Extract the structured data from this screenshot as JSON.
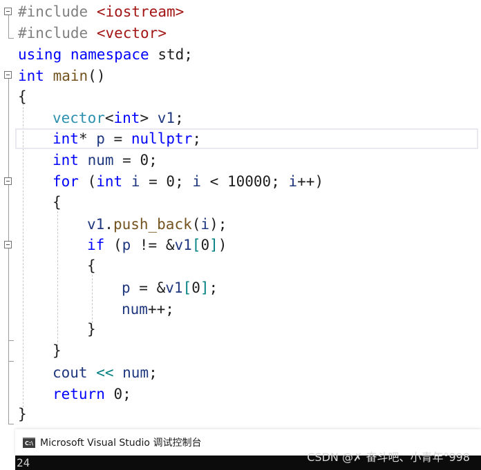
{
  "code": {
    "l1": {
      "t1": "#include",
      "t2": "<iostream>"
    },
    "l2": {
      "t1": "#include",
      "t2": "<vector>"
    },
    "l3": {
      "t1": "using",
      "t2": "namespace",
      "t3": "std;"
    },
    "l4": {
      "t1": "int",
      "t2": "main",
      "t3": "()"
    },
    "l5": {
      "t1": "{"
    },
    "l6": {
      "t1": "vector",
      "t2": "<",
      "t3": "int",
      "t4": ">",
      "t5": "v1",
      "t6": ";"
    },
    "l7": {
      "t1": "int",
      "t2": "*",
      "t3": "p",
      "t4": " = ",
      "t5": "nullptr",
      "t6": ";"
    },
    "l8": {
      "t1": "int",
      "t2": "num",
      "t3": " = ",
      "t4": "0",
      "t5": ";"
    },
    "l9": {
      "t1": "for",
      "t2": " (",
      "t3": "int",
      "t4": "i",
      "t5": " = ",
      "t6": "0",
      "t7": "; ",
      "t8": "i",
      "t9": " < ",
      "t10": "10000",
      "t11": "; ",
      "t12": "i",
      "t13": "++",
      "t14": ")"
    },
    "l10": {
      "t1": "{"
    },
    "l11": {
      "t1": "v1",
      "t2": ".",
      "t3": "push_back",
      "t4": "(",
      "t5": "i",
      "t6": ");"
    },
    "l12": {
      "t1": "if",
      "t2": " (",
      "t3": "p",
      "t4": " != ",
      "t5": "&",
      "t6": "v1",
      "t7": "[",
      "t8": "0",
      "t9": "]",
      "t10": ")"
    },
    "l13": {
      "t1": "{"
    },
    "l14": {
      "t1": "p",
      "t2": " = ",
      "t3": "&",
      "t4": "v1",
      "t5": "[",
      "t6": "0",
      "t7": "]",
      "t8": ";"
    },
    "l15": {
      "t1": "num",
      "t2": "++",
      "t3": ";"
    },
    "l16": {
      "t1": "}"
    },
    "l17": {
      "t1": "}"
    },
    "l18": {
      "t1": "cout",
      "t2": " << ",
      "t3": "num",
      "t4": ";"
    },
    "l19": {
      "t1": "return",
      "t2": " ",
      "t3": "0",
      "t4": ";"
    },
    "l20": {
      "t1": "}"
    }
  },
  "console": {
    "icon_label": "C:\\",
    "title": "Microsoft Visual Studio 调试控制台",
    "output": "24"
  },
  "watermark": "CSDN @✗ 奋斗吧、小青年°998"
}
